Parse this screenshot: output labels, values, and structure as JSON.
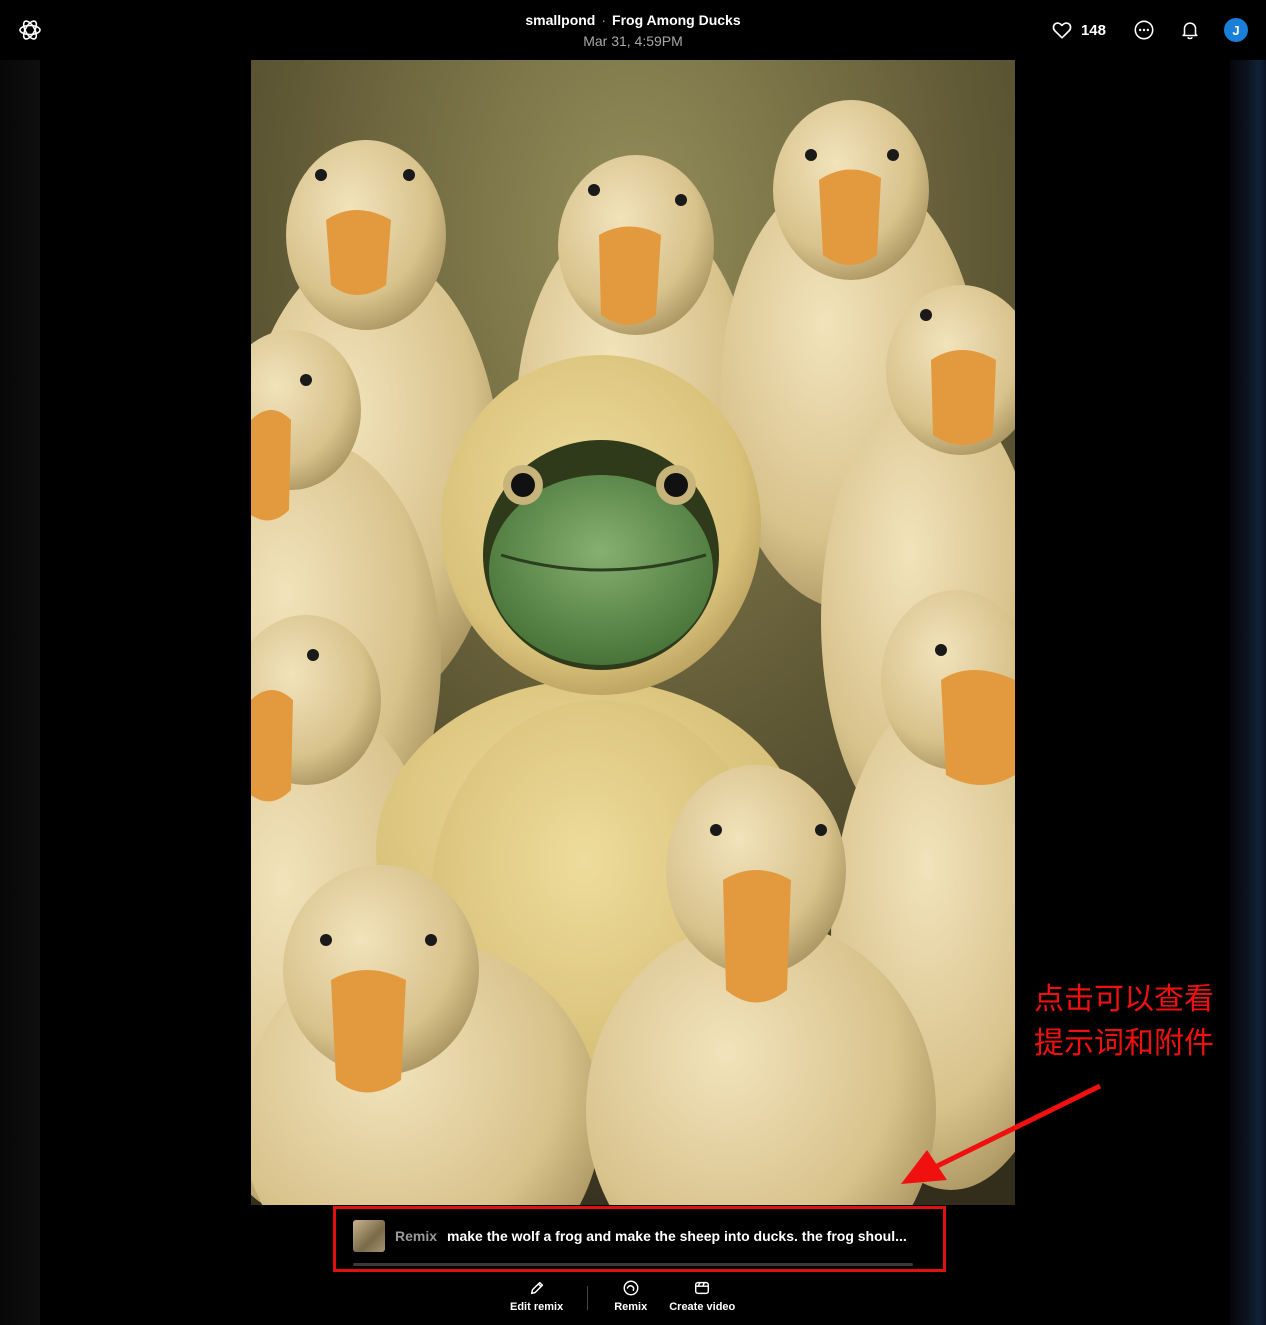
{
  "header": {
    "author": "smallpond",
    "separator": "·",
    "title": "Frog Among Ducks",
    "date": "Mar 31, 4:59PM",
    "like_count": "148",
    "avatar_initial": "J"
  },
  "prompt": {
    "tag": "Remix",
    "text": "make the wolf a frog and make the sheep into ducks. the frog shoul..."
  },
  "actions": {
    "edit_remix": "Edit remix",
    "remix": "Remix",
    "create_video": "Create video"
  },
  "annotation": {
    "line1": "点击可以查看",
    "line2": "提示词和附件",
    "color": "#f01010"
  },
  "icons": {
    "logo": "openai-logo-icon",
    "like": "heart-icon",
    "more": "more-options-icon",
    "notifications": "bell-icon",
    "edit": "pencil-icon",
    "remix": "remix-icon",
    "video": "clapperboard-icon"
  },
  "colors": {
    "background": "#000000",
    "avatar": "#1a7fd9",
    "highlight_box": "#e01010"
  }
}
